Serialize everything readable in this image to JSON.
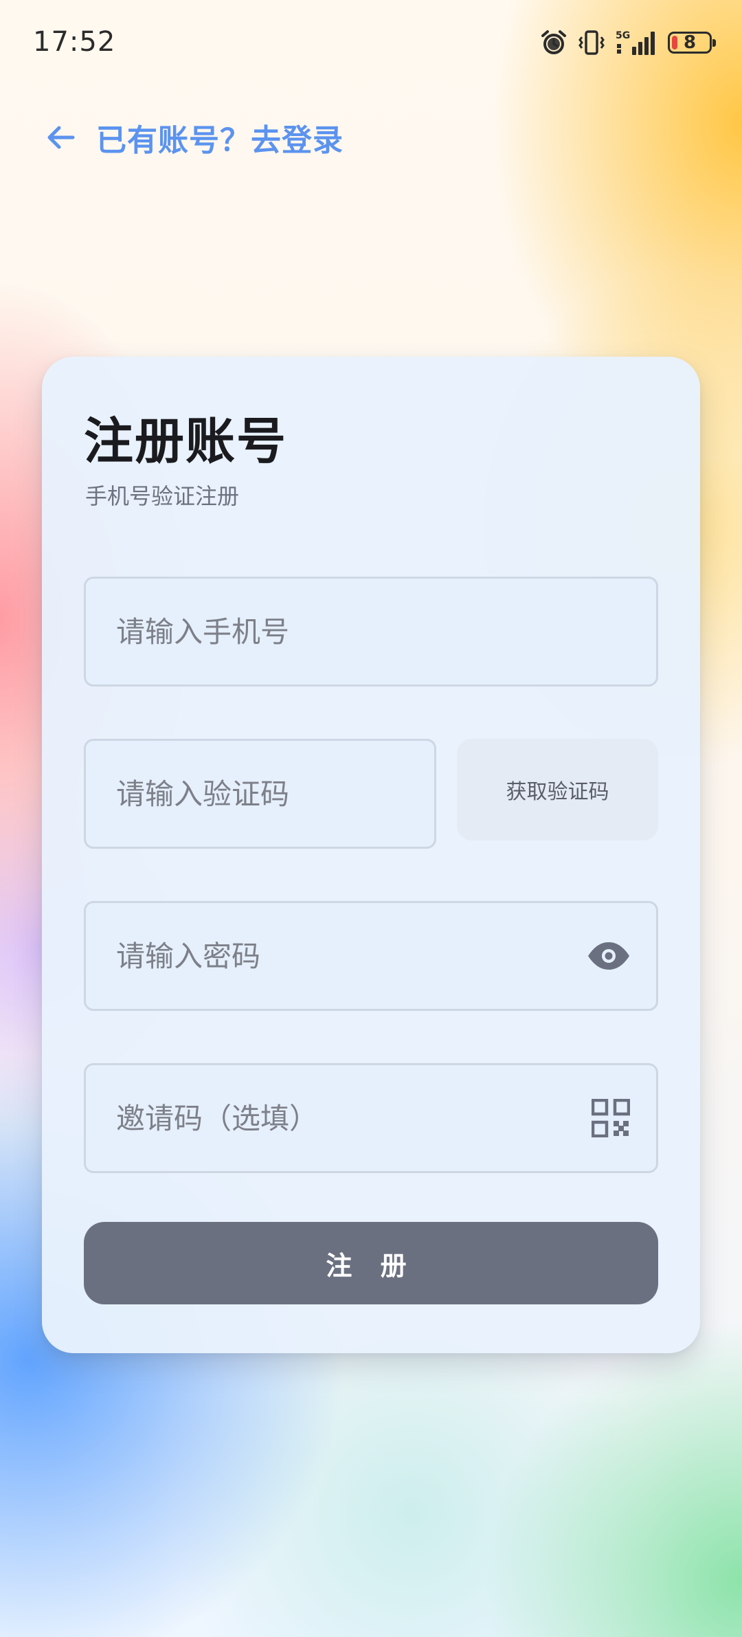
{
  "status_bar": {
    "time": "17:52",
    "network": "5G",
    "battery": "8",
    "icons": [
      "alarm-icon",
      "vibrate-icon",
      "signal-5g-icon",
      "battery-icon"
    ]
  },
  "nav": {
    "back_icon": "arrow-left-icon",
    "login_link": "已有账号？去登录"
  },
  "card": {
    "title": "注册账号",
    "subtitle": "手机号验证注册"
  },
  "form": {
    "phone": {
      "placeholder": "请输入手机号",
      "value": ""
    },
    "code": {
      "placeholder": "请输入验证码",
      "value": ""
    },
    "get_code_button": "获取验证码",
    "password": {
      "placeholder": "请输入密码",
      "value": "",
      "toggle_icon": "eye-icon"
    },
    "invite": {
      "placeholder": "邀请码（选填）",
      "value": "",
      "scan_icon": "qr-code-icon"
    },
    "submit": "注 册"
  },
  "colors": {
    "accent_link": "#5b93ef",
    "button_bg": "#6b7080",
    "card_bg": "#e8f1fd",
    "battery_low": "#e5483f"
  }
}
